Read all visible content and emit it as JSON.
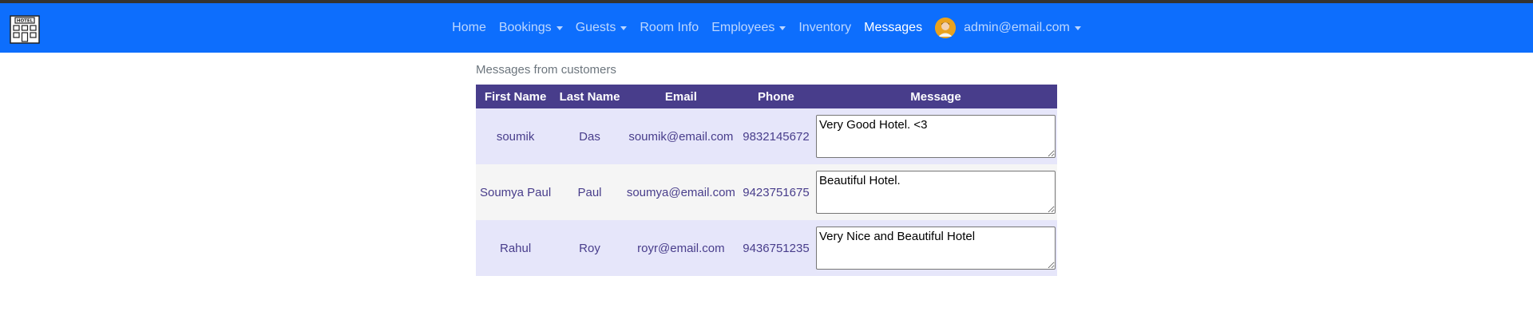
{
  "colors": {
    "navbar_bg": "#0d6efd",
    "table_header_bg": "#483d8b",
    "row_odd_bg": "#e6e6fa",
    "row_even_bg": "#f5f5f5",
    "cell_text": "#483d8b"
  },
  "brand": {
    "icon": "hotel-icon",
    "logo_text": "HOTEL"
  },
  "nav": {
    "home": "Home",
    "bookings": "Bookings",
    "guests": "Guests",
    "room_info": "Room Info",
    "employees": "Employees",
    "inventory": "Inventory",
    "messages": "Messages",
    "user_email": "admin@email.com",
    "active": "Messages"
  },
  "page": {
    "subtitle": "Messages from customers"
  },
  "table": {
    "headers": [
      "First Name",
      "Last Name",
      "Email",
      "Phone",
      "Message"
    ],
    "rows": [
      {
        "first_name": "soumik",
        "last_name": "Das",
        "email": "soumik@email.com",
        "phone": "9832145672",
        "message": "Very Good Hotel. <3"
      },
      {
        "first_name": "Soumya Paul",
        "last_name": "Paul",
        "email": "soumya@email.com",
        "phone": "9423751675",
        "message": "Beautiful Hotel."
      },
      {
        "first_name": "Rahul",
        "last_name": "Roy",
        "email": "royr@email.com",
        "phone": "9436751235",
        "message": "Very Nice and Beautiful Hotel"
      }
    ]
  }
}
